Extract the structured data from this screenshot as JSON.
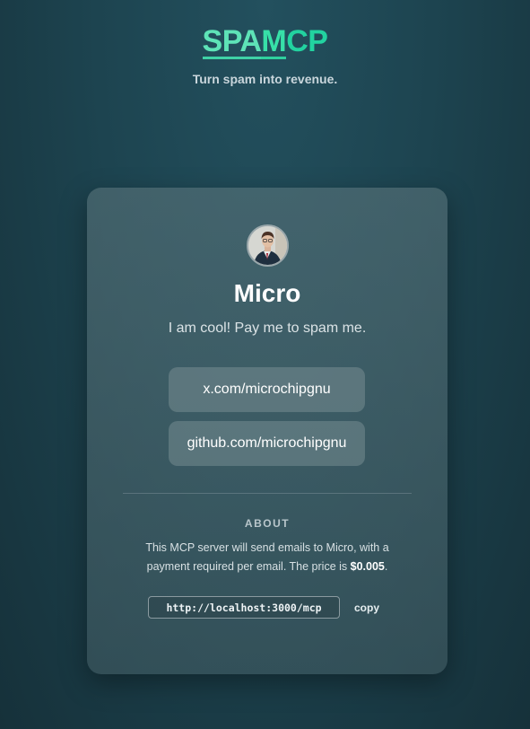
{
  "header": {
    "logo_part1": "SPA",
    "logo_part2": "M",
    "logo_part3": "CP",
    "tagline": "Turn spam into revenue."
  },
  "profile": {
    "name": "Micro",
    "bio": "I am cool! Pay me to spam me.",
    "links": [
      {
        "label": "x.com/microchipgnu"
      },
      {
        "label": "github.com/microchipgnu"
      }
    ]
  },
  "about": {
    "title": "ABOUT",
    "text_before_price": "This MCP server will send emails to Micro, with a payment required per email. The price is ",
    "price": "$0.005",
    "text_after_price": ".",
    "endpoint_url": "http://localhost:3000/mcp",
    "copy_label": "copy"
  },
  "colors": {
    "accent": "#22d3a0",
    "background": "#1d4450"
  }
}
